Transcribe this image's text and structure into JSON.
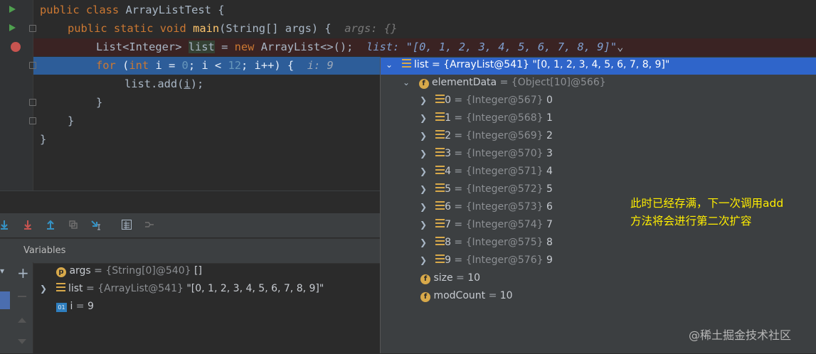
{
  "code": {
    "line1": {
      "kw": "public class ",
      "name": "ArrayListTest",
      "brace": " {"
    },
    "line2": {
      "kw": "public static void ",
      "fn": "main",
      "params": "(String[] args) {",
      "hint": "args: {}"
    },
    "line3": {
      "type": "List<Integer> ",
      "var": "list",
      "eq": " = ",
      "kw": "new ",
      "rest": "ArrayList<>();",
      "inline": "list: \"[0, 1, 2, 3, 4, 5, 6, 7, 8, 9]\"",
      "chev": "⌄"
    },
    "line4": {
      "kw1": "for ",
      "p1": "(",
      "kw2": "int ",
      "i1": "i",
      "p2": " = ",
      "n0": "0",
      "p3": "; ",
      "i2": "i",
      "p4": " < ",
      "n12": "12",
      "p5": "; ",
      "i3": "i",
      "p6": "++) {",
      "hint": "i: 9"
    },
    "line5": {
      "a": "list.add(",
      "i": "i",
      "b": ");"
    },
    "line6": "}",
    "line7": "}",
    "line8": "}"
  },
  "debugger": {
    "variables_tab": "Variables",
    "add_symbol": "+",
    "vars": [
      {
        "icon": "p",
        "name": "args",
        "eq": " = ",
        "type": "{String[0]@540}",
        "value": " []"
      },
      {
        "icon": "list",
        "name": "list",
        "eq": " = ",
        "type": "{ArrayList@541}",
        "value": " \"[0, 1, 2, 3, 4, 5, 6, 7, 8, 9]\""
      },
      {
        "icon": "01",
        "name": "i",
        "eq": " = ",
        "type": "",
        "value": "9"
      }
    ]
  },
  "popup": {
    "root": {
      "name": "list",
      "eq": " = ",
      "type": "{ArrayList@541}",
      "value": " \"[0, 1, 2, 3, 4, 5, 6, 7, 8, 9]\""
    },
    "elementData": {
      "name": "elementData",
      "eq": " = ",
      "type": "{Object[10]@566}"
    },
    "elements": [
      {
        "idx": "0",
        "type": "{Integer@567}",
        "val": " 0"
      },
      {
        "idx": "1",
        "type": "{Integer@568}",
        "val": " 1"
      },
      {
        "idx": "2",
        "type": "{Integer@569}",
        "val": " 2"
      },
      {
        "idx": "3",
        "type": "{Integer@570}",
        "val": " 3"
      },
      {
        "idx": "4",
        "type": "{Integer@571}",
        "val": " 4"
      },
      {
        "idx": "5",
        "type": "{Integer@572}",
        "val": " 5"
      },
      {
        "idx": "6",
        "type": "{Integer@573}",
        "val": " 6"
      },
      {
        "idx": "7",
        "type": "{Integer@574}",
        "val": " 7"
      },
      {
        "idx": "8",
        "type": "{Integer@575}",
        "val": " 8"
      },
      {
        "idx": "9",
        "type": "{Integer@576}",
        "val": " 9"
      }
    ],
    "size": {
      "name": "size",
      "eq": " = ",
      "value": "10"
    },
    "modCount": {
      "name": "modCount",
      "eq": " = ",
      "value": "10"
    }
  },
  "annotation": {
    "line1": "此时已经存满，下一次调用add",
    "line2": "方法将会进行第二次扩容"
  },
  "watermark": "@稀土掘金技术社区",
  "colors": {
    "editor_bg": "#2b2b2b",
    "selection": "#2f65ca",
    "exec_line": "#2d5d99",
    "breakpoint": "#c75450",
    "annotation": "#ffee00"
  }
}
